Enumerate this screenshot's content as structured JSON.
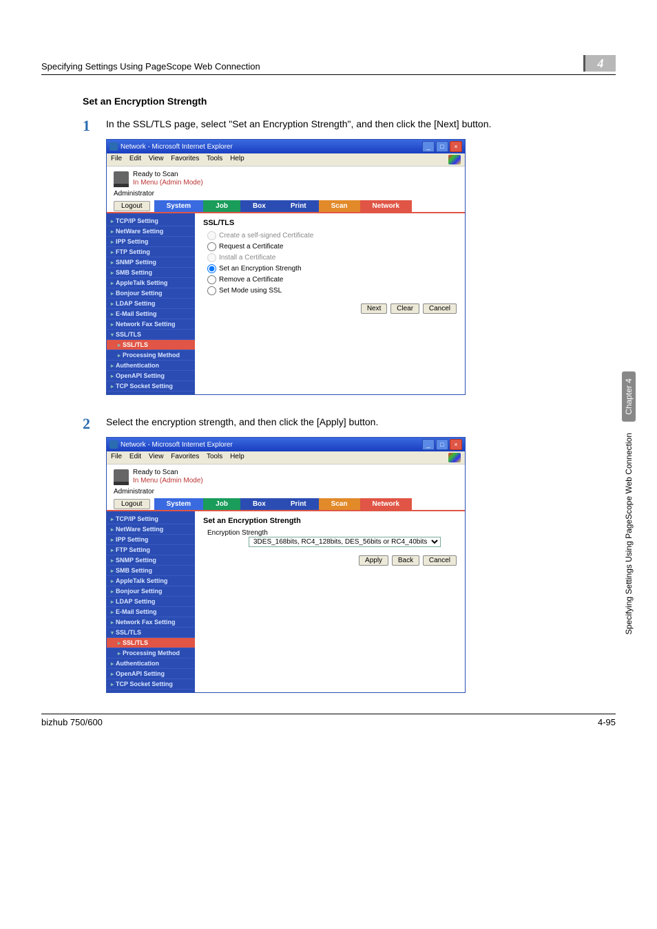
{
  "header": {
    "title": "Specifying Settings Using PageScope Web Connection",
    "section_number": "4"
  },
  "subheading": "Set an Encryption Strength",
  "steps": [
    {
      "num": "1",
      "text": "In the SSL/TLS page, select \"Set an Encryption Strength\", and then click the [Next] button."
    },
    {
      "num": "2",
      "text": "Select the encryption strength, and then click the [Apply] button."
    }
  ],
  "ie": {
    "title": "Network - Microsoft Internet Explorer",
    "menus": [
      "File",
      "Edit",
      "View",
      "Favorites",
      "Tools",
      "Help"
    ],
    "ready": "Ready to Scan",
    "menu_admin": "In Menu (Admin Mode)",
    "administrator": "Administrator",
    "logout": "Logout",
    "tabs": {
      "system": "System",
      "job": "Job",
      "box": "Box",
      "print": "Print",
      "scan": "Scan",
      "network": "Network"
    },
    "sidenav": [
      {
        "label": "TCP/IP Setting"
      },
      {
        "label": "NetWare Setting"
      },
      {
        "label": "IPP Setting"
      },
      {
        "label": "FTP Setting"
      },
      {
        "label": "SNMP Setting"
      },
      {
        "label": "SMB Setting"
      },
      {
        "label": "AppleTalk Setting"
      },
      {
        "label": "Bonjour Setting"
      },
      {
        "label": "LDAP Setting"
      },
      {
        "label": "E-Mail Setting"
      },
      {
        "label": "Network Fax Setting"
      },
      {
        "label": "SSL/TLS",
        "open": true
      },
      {
        "label": "SSL/TLS",
        "sub": true,
        "active": true
      },
      {
        "label": "Processing Method",
        "sub": true
      },
      {
        "label": "Authentication"
      },
      {
        "label": "OpenAPI Setting"
      },
      {
        "label": "TCP Socket Setting"
      }
    ]
  },
  "panel1": {
    "title": "SSL/TLS",
    "options": [
      {
        "label": "Create a self-signed Certificate",
        "checked": false,
        "disabled": true
      },
      {
        "label": "Request a Certificate",
        "checked": false
      },
      {
        "label": "Install a Certificate",
        "checked": false,
        "disabled": true
      },
      {
        "label": "Set an Encryption Strength",
        "checked": true
      },
      {
        "label": "Remove a Certificate",
        "checked": false
      },
      {
        "label": "Set Mode using SSL",
        "checked": false
      }
    ],
    "buttons": {
      "next": "Next",
      "clear": "Clear",
      "cancel": "Cancel"
    }
  },
  "panel2": {
    "title": "Set an Encryption Strength",
    "field_label": "Encryption Strength",
    "select_value": "3DES_168bits, RC4_128bits, DES_56bits or RC4_40bits",
    "buttons": {
      "apply": "Apply",
      "back": "Back",
      "cancel": "Cancel"
    }
  },
  "sidebar": {
    "chapter": "Chapter 4",
    "long": "Specifying Settings Using PageScope Web Connection"
  },
  "footer": {
    "left": "bizhub 750/600",
    "right": "4-95"
  }
}
